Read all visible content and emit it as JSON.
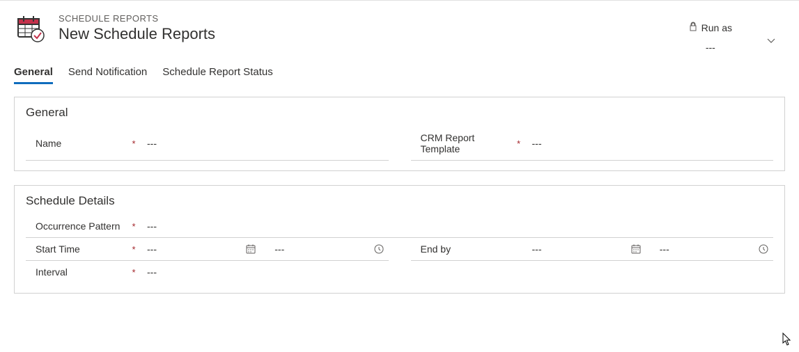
{
  "header": {
    "breadcrumb": "SCHEDULE REPORTS",
    "title": "New Schedule Reports"
  },
  "runas": {
    "label": "Run as",
    "value": "---"
  },
  "tabs": [
    {
      "label": "General",
      "active": true
    },
    {
      "label": "Send Notification",
      "active": false
    },
    {
      "label": "Schedule Report Status",
      "active": false
    }
  ],
  "sections": {
    "general": {
      "title": "General",
      "fields": {
        "name": {
          "label": "Name",
          "required": true,
          "value": "---"
        },
        "crmTemplate": {
          "label": "CRM Report Template",
          "required": true,
          "value": "---"
        }
      }
    },
    "schedule": {
      "title": "Schedule Details",
      "fields": {
        "occurrence": {
          "label": "Occurrence Pattern",
          "required": true,
          "value": "---"
        },
        "startTime": {
          "label": "Start Time",
          "required": true,
          "date": "---",
          "time": "---"
        },
        "endBy": {
          "label": "End by",
          "required": false,
          "date": "---",
          "time": "---"
        },
        "interval": {
          "label": "Interval",
          "required": true,
          "value": "---"
        }
      }
    }
  },
  "requiredMark": "*"
}
